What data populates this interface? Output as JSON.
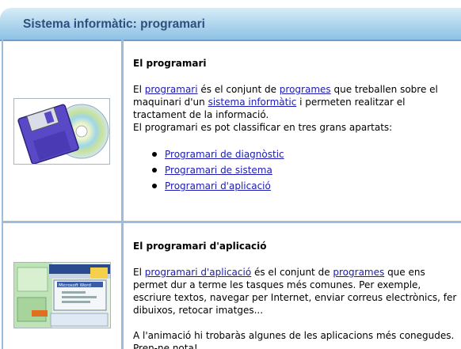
{
  "header": {
    "title": "Sistema informàtic: programari"
  },
  "section1": {
    "title": "El programari",
    "p1_pre": "El ",
    "p1_link1": "programari",
    "p1_mid1": " és el conjunt de ",
    "p1_link2": "programes",
    "p1_mid2": " que treballen sobre el maquinari d'un ",
    "p1_link3": "sistema informàtic",
    "p1_post": " i permeten realitzar el tractament de la informació.",
    "p2": "El programari es pot classificar en tres grans apartats:",
    "links": [
      "Programari de diagnòstic",
      "Programari de sistema",
      "Programari d'aplicació"
    ]
  },
  "section2": {
    "title": "El programari d'aplicació",
    "p1_pre": "El ",
    "p1_link1": "programari d'aplicació",
    "p1_mid1": " és el conjunt de ",
    "p1_link2": "programes",
    "p1_post": " que ens permet dur a terme les tasques més comunes. Per exemple, escriure textos, navegar per Internet, enviar correus electrònics, fer dibuixos, retocar imatges...",
    "p2": "A l'animació hi trobaràs algunes de les aplicacions més conegudes. Pren-ne nota!",
    "thumb_window_title": "Microsoft Word"
  },
  "colors": {
    "header_text": "#2f4f7c",
    "link": "#1b1bb3",
    "divider": "#9cbcd9"
  }
}
